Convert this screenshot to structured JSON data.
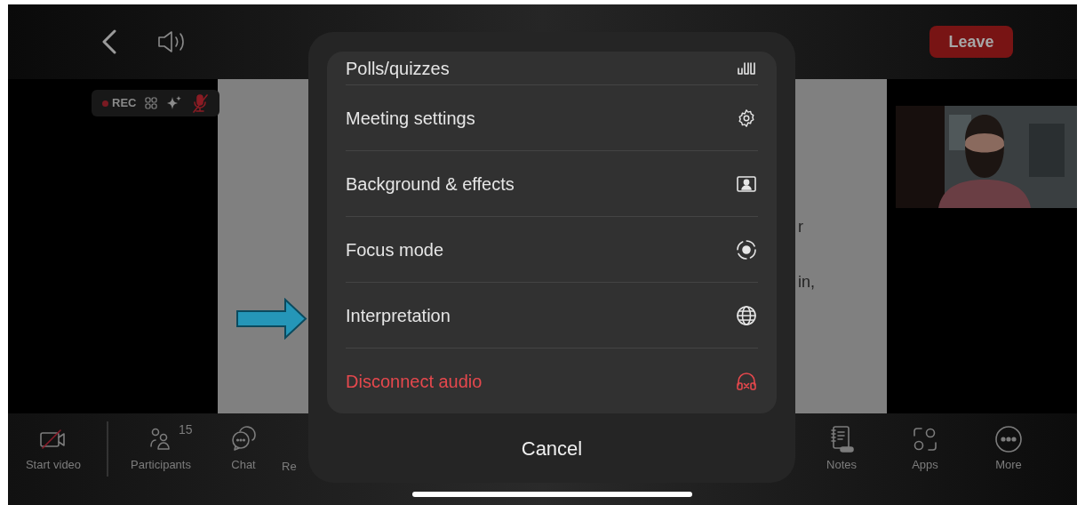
{
  "top_bar": {
    "leave_button": "Leave"
  },
  "status_pill": {
    "recording_label": "REC"
  },
  "shared_document": {
    "fragments": [
      "r",
      "in,"
    ]
  },
  "toolbar": {
    "items": [
      {
        "label": "Start video",
        "kind": "video"
      },
      {
        "label": "Participants",
        "kind": "participants",
        "badge": "15"
      },
      {
        "label": "Chat",
        "kind": "chat"
      },
      {
        "label": "Re",
        "kind": "cut"
      },
      {
        "label": "Notes",
        "kind": "notes"
      },
      {
        "label": "Apps",
        "kind": "apps"
      },
      {
        "label": "More",
        "kind": "more"
      }
    ]
  },
  "menu": {
    "items": [
      {
        "label": "Polls/quizzes",
        "kind": "polls",
        "destructive": false
      },
      {
        "label": "Meeting settings",
        "kind": "settings",
        "destructive": false
      },
      {
        "label": "Background & effects",
        "kind": "background",
        "destructive": false
      },
      {
        "label": "Focus mode",
        "kind": "focus",
        "destructive": false
      },
      {
        "label": "Interpretation",
        "kind": "globe",
        "destructive": false
      },
      {
        "label": "Disconnect audio",
        "kind": "disconnect",
        "destructive": true
      }
    ],
    "cancel": "Cancel"
  }
}
